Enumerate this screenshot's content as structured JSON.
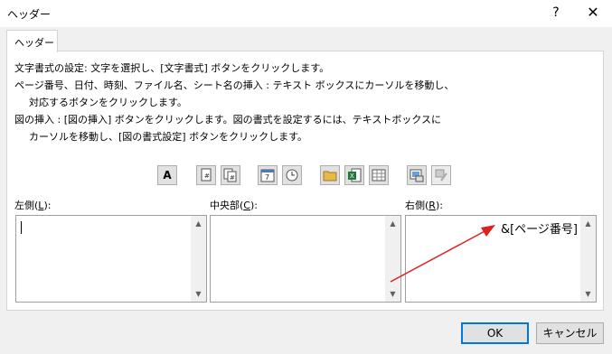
{
  "window": {
    "title": "ヘッダー",
    "help_label": "?",
    "close_label": "✕"
  },
  "tab": {
    "label": "ヘッダー"
  },
  "instructions": [
    "文字書式の設定: 文字を選択し、[文字書式] ボタンをクリックします。",
    "ページ番号、日付、時刻、ファイル名、シート名の挿入 : テキスト ボックスにカーソルを移動し、",
    "対応するボタンをクリックします。",
    "図の挿入 : [図の挿入] ボタンをクリックします。図の書式を設定するには、テキストボックスに",
    "カーソルを移動し、[図の書式設定] ボタンをクリックします。"
  ],
  "toolbar": {
    "format_text_label": "A",
    "icons": [
      "format-text-icon",
      "page-number-icon",
      "number-of-pages-icon",
      "date-icon",
      "time-icon",
      "file-path-icon",
      "file-name-icon",
      "sheet-name-icon",
      "insert-picture-icon",
      "format-picture-icon"
    ]
  },
  "sections": {
    "left": {
      "label": "左側(",
      "key": "L",
      "suffix": "):",
      "value": ""
    },
    "center": {
      "label": "中央部(",
      "key": "C",
      "suffix": "):",
      "value": ""
    },
    "right": {
      "label": "右側(",
      "key": "R",
      "suffix": "):",
      "value": "&[ページ番号]"
    }
  },
  "buttons": {
    "ok": "OK",
    "cancel": "キャンセル"
  },
  "annotation": {
    "arrow_color": "#e02020"
  }
}
